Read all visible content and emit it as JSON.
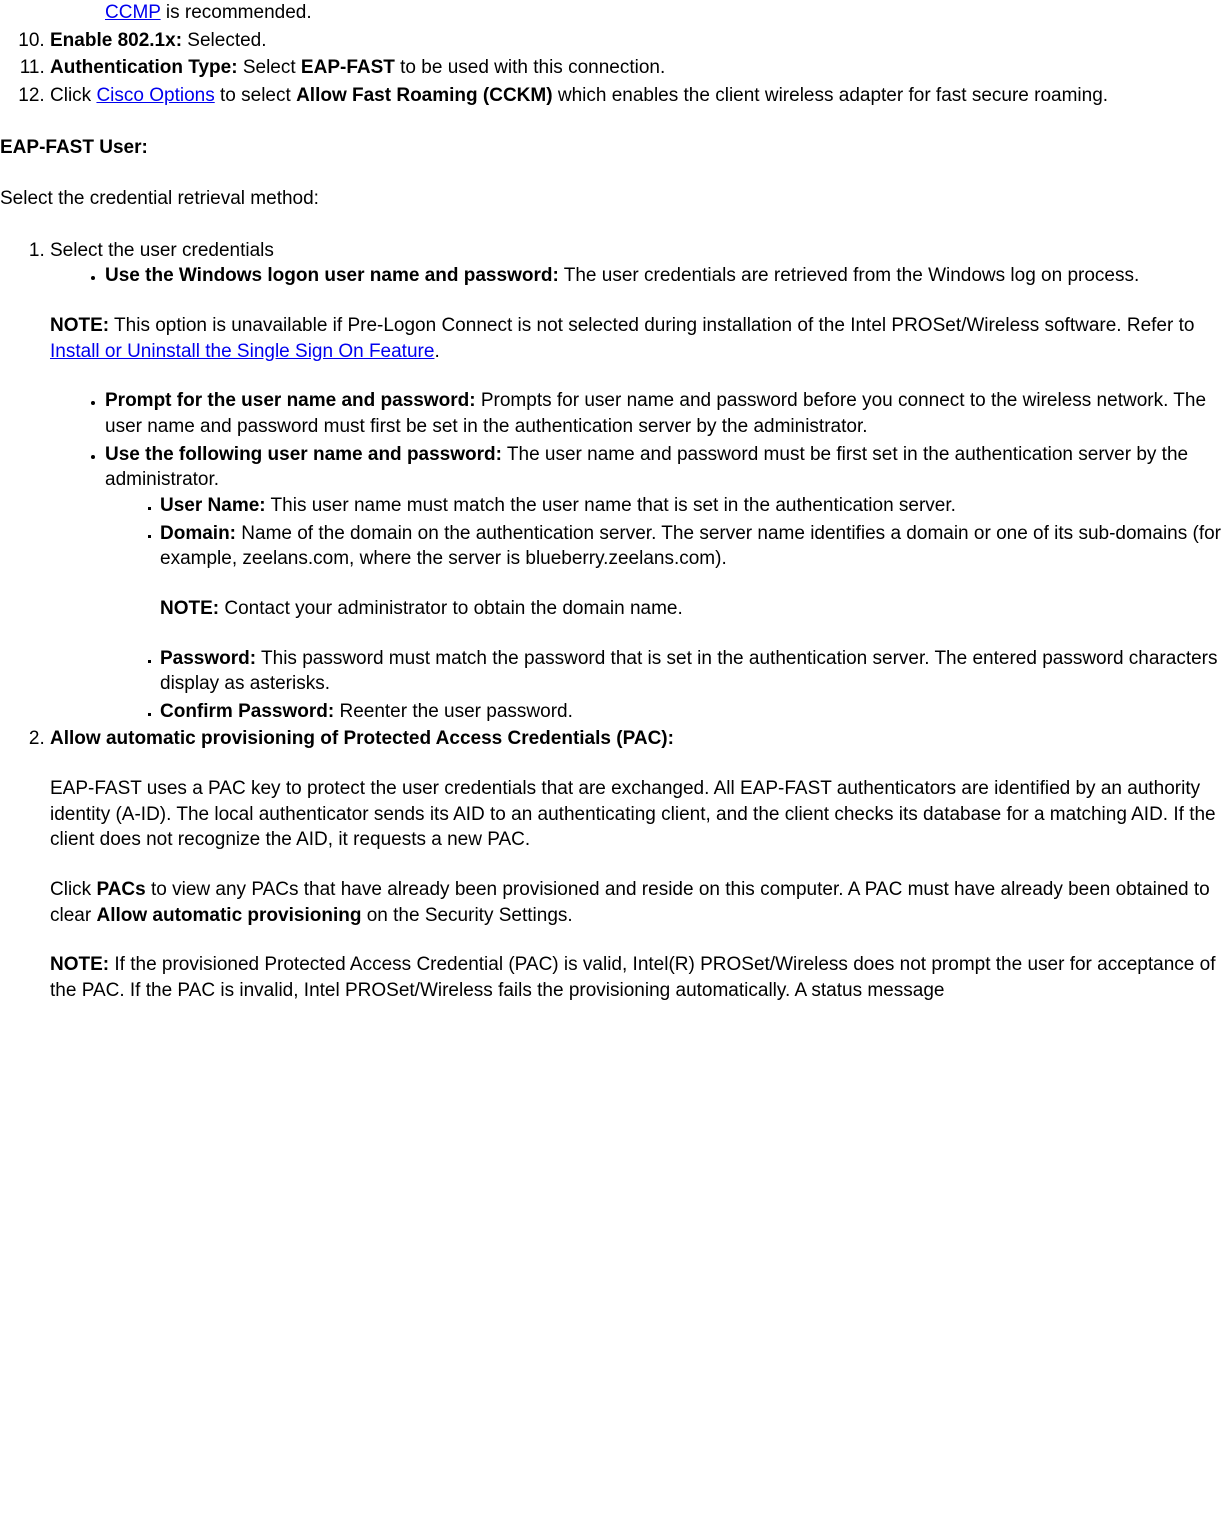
{
  "topList": {
    "item9b": {
      "link": "CCMP",
      "text": " is recommended."
    },
    "item10": {
      "bold": "Enable 802.1x:",
      "text": " Selected."
    },
    "item11": {
      "bold1": "Authentication Type:",
      "text1": " Select ",
      "bold2": "EAP-FAST",
      "text2": " to be used with this connection."
    },
    "item12": {
      "text1": "Click ",
      "link": "Cisco Options",
      "text2": " to select ",
      "bold": "Allow Fast Roaming (CCKM)",
      "text3": " which enables the client wireless adapter for fast secure roaming."
    }
  },
  "heading": "EAP-FAST User:",
  "intro": "Select the credential retrieval method:",
  "list2": {
    "item1": {
      "lead": "Select the user credentials",
      "bullet1": {
        "bold": "Use the Windows logon user name and password:",
        "text": " The user credentials are retrieved from the Windows log on process."
      },
      "note": {
        "bold": "NOTE:",
        "text1": " This option is unavailable if Pre-Logon Connect is not selected during installation of the Intel PROSet/Wireless software. Refer to ",
        "link": "Install or Uninstall the Single Sign On Feature",
        "text2": "."
      },
      "bullet2": {
        "bold": "Prompt for the user name and password:",
        "text": " Prompts for user name and password before you connect to the wireless network. The user name and password must first be set in the authentication server by the administrator."
      },
      "bullet3": {
        "bold": "Use the following user name and password:",
        "text": " The user name and password must be first set in the authentication server by the administrator.",
        "sq1": {
          "bold": "User Name:",
          "text": " This user name must match the user name that is set in the authentication server."
        },
        "sq2": {
          "bold": "Domain:",
          "text": " Name of the domain on the authentication server. The server name identifies a domain or one of its sub-domains (for example, zeelans.com, where the server is blueberry.zeelans.com).",
          "noteBold": "NOTE:",
          "noteText": " Contact your administrator to obtain the domain name."
        },
        "sq3": {
          "bold": "Password:",
          "text": " This password must match the password that is set in the authentication server. The entered password characters display as asterisks."
        },
        "sq4": {
          "bold": "Confirm Password:",
          "text": " Reenter the user password."
        }
      }
    },
    "item2": {
      "bold1": "Allow automatic provisioning of Protected Access Credentials (PAC):",
      "para1": "EAP-FAST uses a PAC key to protect the user credentials that are exchanged. All EAP-FAST authenticators are identified by an authority identity (A-ID). The local authenticator sends its AID to an authenticating client, and the client checks its database for a matching AID. If the client does not recognize the AID, it requests a new PAC.",
      "para2a": "Click ",
      "para2b": "PACs",
      "para2c": " to view any PACs that have already been provisioned and reside on this computer. A PAC must have already been obtained to clear ",
      "para2d": "Allow automatic provisioning",
      "para2e": " on the Security Settings.",
      "noteBold": "NOTE:",
      "noteText": " If the provisioned Protected Access Credential (PAC) is valid, Intel(R) PROSet/Wireless does not prompt the user for acceptance of the PAC. If the PAC is invalid, Intel PROSet/Wireless fails the provisioning automatically. A status message"
    }
  }
}
